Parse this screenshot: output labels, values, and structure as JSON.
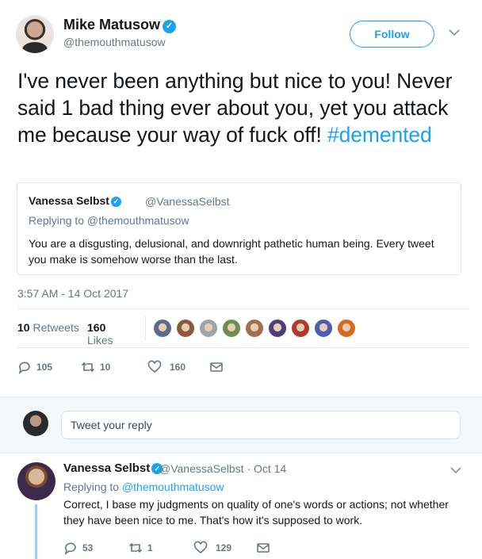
{
  "tweet": {
    "author_name": "Mike Matusow",
    "author_handle": "@themouthmatusow",
    "follow_label": "Follow",
    "text_main": "I've never been anything but nice to you! Never said 1 bad thing ever about you, yet you attack me because your way of fuck off! ",
    "hashtag": "#demented",
    "timestamp": "3:57 AM - 14 Oct 2017",
    "retweets_count": "10",
    "retweets_label": "Retweets",
    "likes_count": "160",
    "likes_label": "Likes",
    "likers": [
      "#5a6b8c",
      "#8b5a3c",
      "#9aa5ad",
      "#6c8f4e",
      "#a07050",
      "#4b3f7a",
      "#b23a2c",
      "#4a5fb0",
      "#d86a1f"
    ],
    "actions": {
      "replies": "105",
      "retweets": "10",
      "likes": "160"
    },
    "accent": "#1da1f2"
  },
  "quote": {
    "name": "Vanessa Selbst",
    "handle": "@VanessaSelbst",
    "replying": "Replying to @themouthmatusow",
    "text": "You are a disgusting, delusional, and downright pathetic human being. Every tweet you make is somehow worse than the last."
  },
  "reply_box": {
    "placeholder": "Tweet your reply"
  },
  "reply": {
    "name": "Vanessa Selbst",
    "handle_date": "@VanessaSelbst · Oct 14",
    "replying_prefix": "Replying to ",
    "replying_mention": "@themouthmatusow",
    "text": "Correct, I base my judgments on quality of one's words or actions; not whether they have been nice to me. That's how it's supposed to work.",
    "actions": {
      "replies": "53",
      "retweets": "1",
      "likes": "129"
    }
  }
}
